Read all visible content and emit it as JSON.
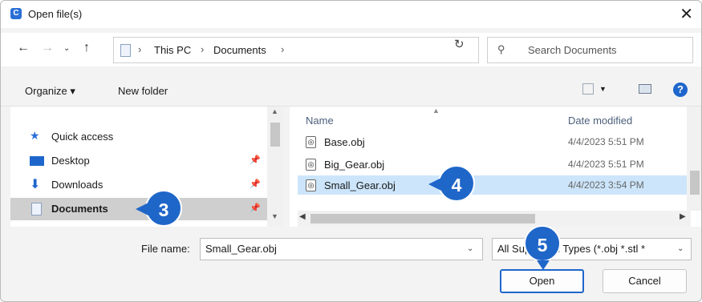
{
  "window": {
    "title": "Open file(s)",
    "app_icon_letter": "C"
  },
  "address": {
    "crumbs": [
      "This PC",
      "Documents"
    ],
    "search_placeholder": "Search Documents"
  },
  "toolbar": {
    "organize_label": "Organize ▾",
    "new_folder_label": "New folder"
  },
  "nav": {
    "items": [
      {
        "label": "Quick access",
        "icon": "star-icon"
      },
      {
        "label": "Desktop",
        "icon": "desktop-icon"
      },
      {
        "label": "Downloads",
        "icon": "download-icon"
      },
      {
        "label": "Documents",
        "icon": "documents-icon",
        "selected": true
      }
    ]
  },
  "filelist": {
    "columns": {
      "name": "Name",
      "date": "Date modified"
    },
    "rows": [
      {
        "name": "Base.obj",
        "date": "4/4/2023 5:51 PM"
      },
      {
        "name": "Big_Gear.obj",
        "date": "4/4/2023 5:51 PM"
      },
      {
        "name": "Small_Gear.obj",
        "date": "4/4/2023 3:54 PM",
        "selected": true
      }
    ]
  },
  "bottom": {
    "file_name_label": "File name:",
    "file_name_value": "Small_Gear.obj",
    "file_type_value": "All Supported Types (*.obj *.stl *",
    "open_label": "Open",
    "cancel_label": "Cancel"
  },
  "badges": {
    "b3": "3",
    "b4": "4",
    "b5": "5"
  },
  "colors": {
    "accent": "#1f66c9",
    "selection": "#cce5fb",
    "nav_selection": "#cfcfcf"
  }
}
